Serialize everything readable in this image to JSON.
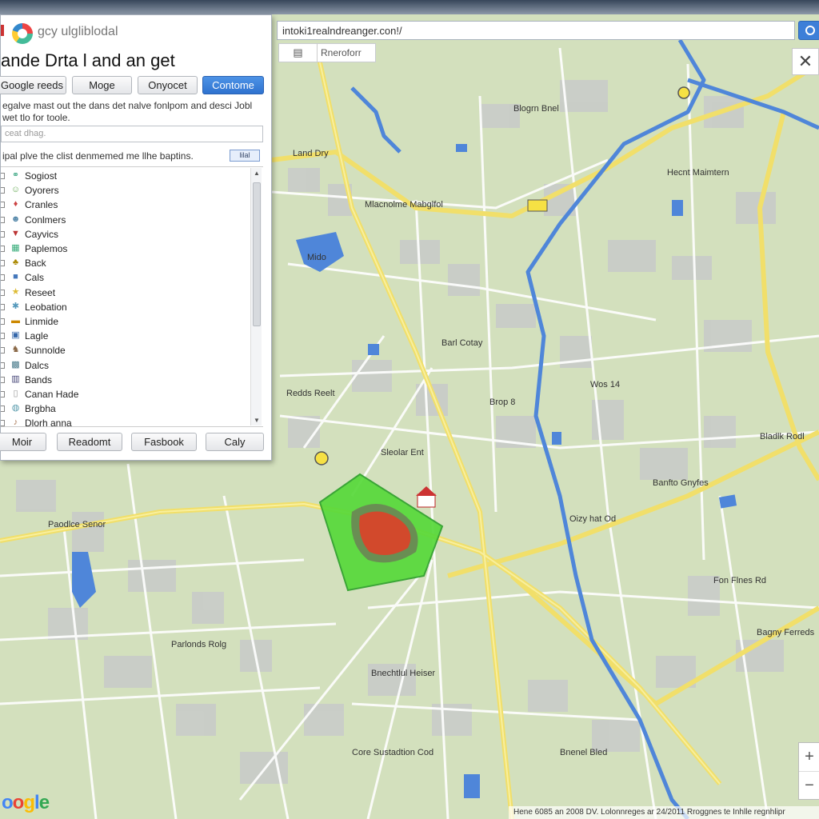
{
  "browser": {
    "address": "intoki1realndreanger.con!/",
    "map_toolbar_label": "Rneroforr"
  },
  "panel": {
    "brand_text": "gcy ulgliblodal",
    "title": "ande Drta l and an get",
    "buttons_top": [
      "Google reeds",
      "Moge",
      "Onyocet",
      "Contome"
    ],
    "description": "egalve mast out the dans det nalve fonlpom and desci Jobl wet tlo for toole.",
    "search_placeholder": "ceat dhag.",
    "instruction": "ipal plve the clist denmemed me llhe baptins.",
    "select_value": "lilal",
    "items": [
      {
        "label": "Sogiost",
        "icon": "share-icon",
        "color": "#4a8"
      },
      {
        "label": "Oyorers",
        "icon": "people-icon",
        "color": "#6a5"
      },
      {
        "label": "Cranles",
        "icon": "pin-icon",
        "color": "#c44"
      },
      {
        "label": "Conlmers",
        "icon": "group-icon",
        "color": "#58a"
      },
      {
        "label": "Cayvics",
        "icon": "flag-icon",
        "color": "#b33"
      },
      {
        "label": "Paplemos",
        "icon": "paper-icon",
        "color": "#3a7"
      },
      {
        "label": "Back",
        "icon": "tree-icon",
        "color": "#a80"
      },
      {
        "label": "Cals",
        "icon": "tag-icon",
        "color": "#47b"
      },
      {
        "label": "Reseet",
        "icon": "star-icon",
        "color": "#db3"
      },
      {
        "label": "Leobation",
        "icon": "cluster-icon",
        "color": "#59b"
      },
      {
        "label": "Linmide",
        "icon": "folder-icon",
        "color": "#c80"
      },
      {
        "label": "Lagle",
        "icon": "image-icon",
        "color": "#36a"
      },
      {
        "label": "Sunnolde",
        "icon": "horse-icon",
        "color": "#864"
      },
      {
        "label": "Dalcs",
        "icon": "grid-icon",
        "color": "#478"
      },
      {
        "label": "Bands",
        "icon": "book-icon",
        "color": "#447"
      },
      {
        "label": "Canan Hade",
        "icon": "page-icon",
        "color": "#999"
      },
      {
        "label": "Brgbha",
        "icon": "globe-icon",
        "color": "#59a"
      },
      {
        "label": "Dlorh anna",
        "icon": "note-icon",
        "color": "#a75"
      }
    ],
    "buttons_bottom": [
      "Moir",
      "Readomt",
      "Fasbook",
      "Caly"
    ]
  },
  "map": {
    "labels": [
      "Land Dry",
      "Mlacnolme Mabglfol",
      "Mido",
      "Barl Cotay",
      "Brop 8",
      "Wos 14",
      "Paodlce Senor",
      "Sleolar Ent",
      "Redds Reelt",
      "Oizy hat Od",
      "Bnechtlul Heiser",
      "Core Sustadtion Cod",
      "Hecnt Maimtern",
      "Banfto Gnyfes",
      "Fon Flnes Rd",
      "Bagny Ferreds",
      "Blogrn Bnel",
      "Bnenel Bled",
      "Parlonds Rolg",
      "Bladlk Rodl"
    ],
    "copyright": "Hene 6085 an 2008 DV. Lolonnreges ar 24/2011 Rroggnes te Inhlle regnhlipr",
    "logo": "oogle",
    "zoom_in": "+",
    "zoom_out": "−"
  },
  "colors": {
    "primary_button": "#3a82dd",
    "highlight_polygon": "#4fd62e",
    "highlight_core": "#c2462a",
    "river": "#4f86d9",
    "major_road": "#f1df6a",
    "park": "#d5e2c0"
  }
}
